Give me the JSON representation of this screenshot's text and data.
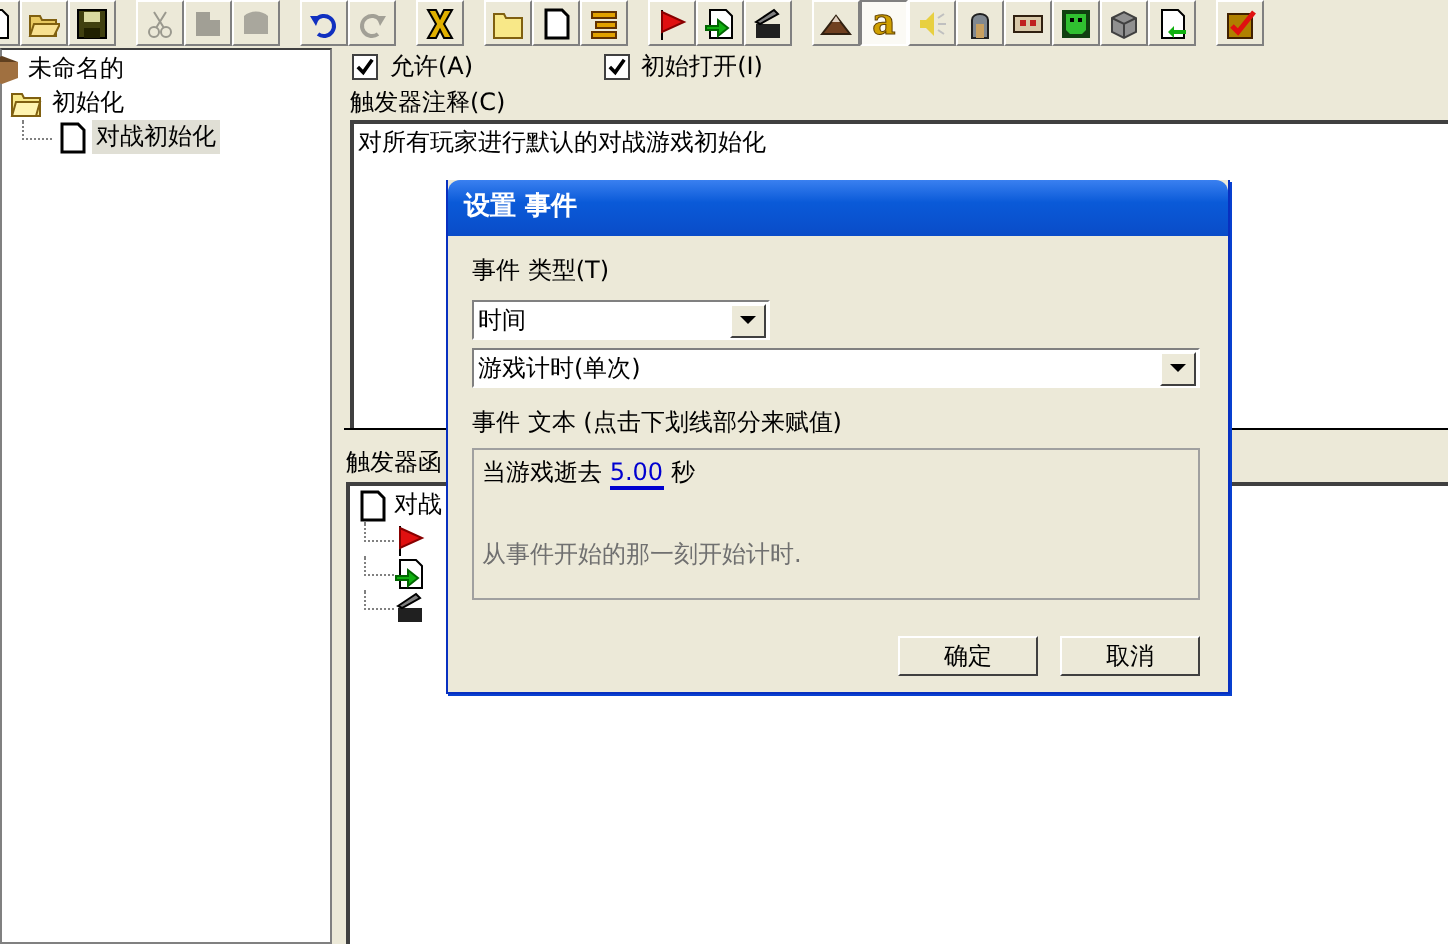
{
  "toolbar": {
    "groups": [
      {
        "buttons": [
          {
            "disabled": false,
            "pressed": false
          },
          {
            "disabled": false,
            "pressed": false
          },
          {
            "disabled": false,
            "pressed": false
          }
        ]
      },
      {
        "buttons": [
          {
            "disabled": true,
            "pressed": false
          },
          {
            "disabled": true,
            "pressed": false
          },
          {
            "disabled": true,
            "pressed": false
          }
        ]
      },
      {
        "buttons": [
          {
            "disabled": false,
            "pressed": false
          },
          {
            "disabled": true,
            "pressed": false
          }
        ]
      },
      {
        "buttons": [
          {
            "disabled": false,
            "pressed": false
          }
        ]
      },
      {
        "buttons": [
          {
            "disabled": false,
            "pressed": false
          },
          {
            "disabled": false,
            "pressed": false
          },
          {
            "disabled": false,
            "pressed": false
          }
        ]
      },
      {
        "buttons": [
          {
            "disabled": false,
            "pressed": false
          },
          {
            "disabled": false,
            "pressed": false
          },
          {
            "disabled": false,
            "pressed": false
          }
        ]
      },
      {
        "buttons": [
          {
            "disabled": false,
            "pressed": false
          },
          {
            "disabled": false,
            "pressed": true,
            "glyph": "a"
          },
          {
            "disabled": false,
            "pressed": false
          },
          {
            "disabled": false,
            "pressed": false
          },
          {
            "disabled": false,
            "pressed": false
          },
          {
            "disabled": false,
            "pressed": false
          },
          {
            "disabled": false,
            "pressed": false
          },
          {
            "disabled": false,
            "pressed": false
          }
        ]
      },
      {
        "buttons": [
          {
            "disabled": false,
            "pressed": false
          }
        ]
      }
    ]
  },
  "tree": {
    "label": "未命名的",
    "expanded": true,
    "children": [
      {
        "label": "初始化",
        "expanded": true,
        "children": [
          {
            "label": "对战初始化",
            "selected": true
          }
        ]
      }
    ]
  },
  "options": [
    {
      "label": "允许(A)",
      "checked": true
    },
    {
      "label": "初始打开(I)",
      "checked": true
    }
  ],
  "comment": {
    "label": "触发器注释(C)",
    "value": "对所有玩家进行默认的对战游戏初始化"
  },
  "functions": {
    "label": "触发器函",
    "root": "对战",
    "items": [
      {
        "kind": "event"
      },
      {
        "kind": "condition"
      },
      {
        "kind": "action"
      }
    ]
  },
  "dialog": {
    "title": "设置 事件",
    "type_label": "事件 类型(T)",
    "category": "时间",
    "event": "游戏计时(单次)",
    "text_label": "事件 文本 (点击下划线部分来赋值)",
    "sentence": {
      "before": "当游戏逝去",
      "link": "5.00",
      "after": "秒"
    },
    "description": "从事件开始的那一刻开始计时.",
    "buttons": [
      "确定",
      "取消"
    ]
  }
}
